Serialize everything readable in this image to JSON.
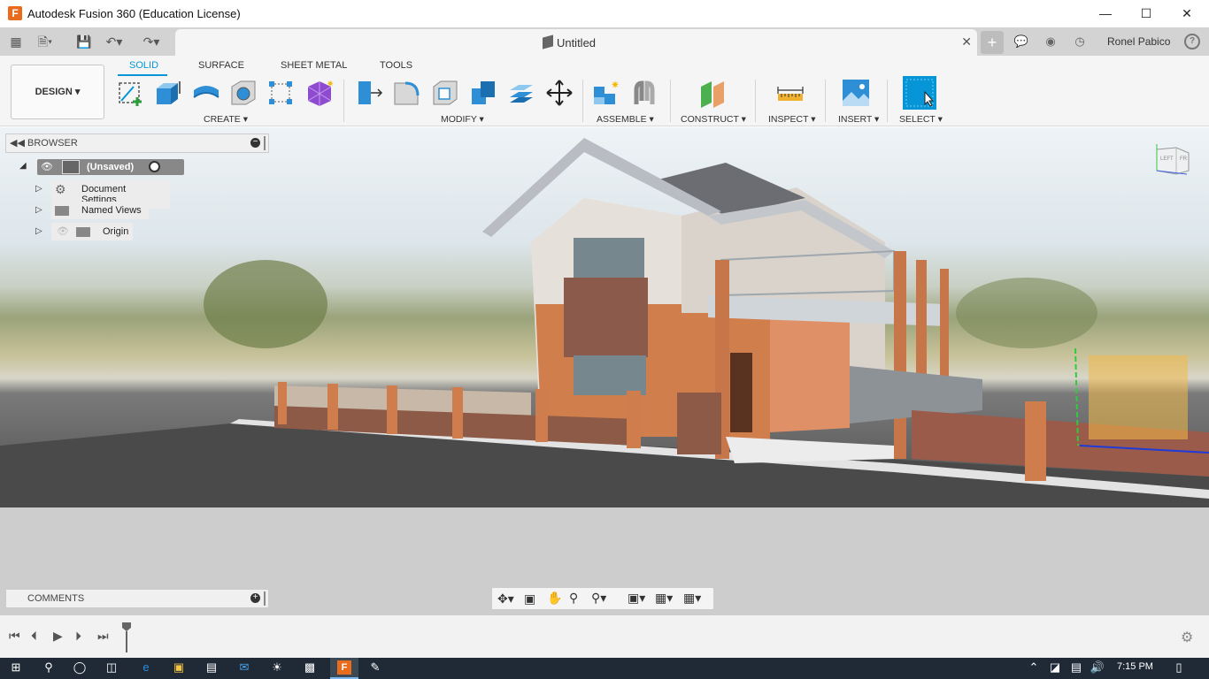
{
  "window": {
    "title": "Autodesk Fusion 360 (Education License)",
    "app_logo": "F",
    "controls": [
      "minimize",
      "maximize",
      "close"
    ]
  },
  "document": {
    "tab_title": "Untitled",
    "user_name": "Ronel Pabico"
  },
  "ribbon": {
    "workspace": "DESIGN ▾",
    "tabs": [
      "SOLID",
      "SURFACE",
      "SHEET METAL",
      "TOOLS"
    ],
    "active_tab": "SOLID",
    "groups": [
      "CREATE ▾",
      "MODIFY ▾",
      "ASSEMBLE ▾",
      "CONSTRUCT ▾",
      "INSPECT ▾",
      "INSERT ▾",
      "SELECT ▾"
    ]
  },
  "browser": {
    "title": "BROWSER",
    "root": "(Unsaved)",
    "items": [
      "Document Settings",
      "Named Views",
      "Origin"
    ]
  },
  "comments": {
    "title": "COMMENTS"
  },
  "viewcube": {
    "left": "LEFT",
    "front": "FR"
  },
  "taskbar": {
    "time": "7:15 PM"
  },
  "colors": {
    "accent": "#0696d7",
    "taskbar": "#1f2a36"
  }
}
